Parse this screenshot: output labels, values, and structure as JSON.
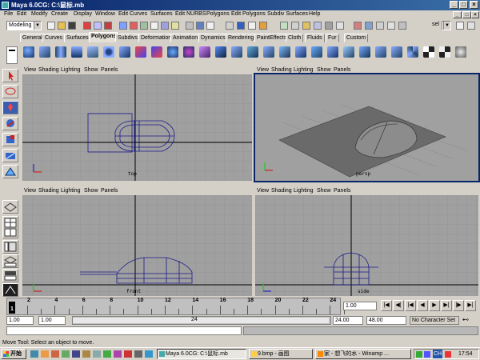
{
  "window": {
    "title": "Maya 6.0CG: C:\\鼠标.mb"
  },
  "menu": [
    "File",
    "Edit",
    "Modify",
    "Create",
    "Display",
    "Window",
    "Edit Curves",
    "Surfaces",
    "Edit NURBS",
    "Polygons",
    "Edit Polygons",
    "Subdiv Surfaces",
    "Help"
  ],
  "toolbar": {
    "mode": "Modeling",
    "sel_label": "sel"
  },
  "shelf_tabs": [
    "General",
    "Curves",
    "Surfaces",
    "Polygons",
    "Subdivs",
    "Deformation",
    "Animation",
    "Dynamics",
    "Rendering",
    "PaintEffects",
    "Cloth",
    "Fluids",
    "Fur",
    "Custom"
  ],
  "active_shelf": "Polygons",
  "viewports": {
    "menu": [
      "View",
      "Shading",
      "Lighting",
      "Show",
      "Panels"
    ],
    "top_label": "top",
    "persp_label": "persp",
    "front_label": "front",
    "side_label": "side"
  },
  "timeline": {
    "ticks": [
      "2",
      "4",
      "6",
      "8",
      "10",
      "12",
      "14",
      "16",
      "18",
      "20",
      "22",
      "24"
    ],
    "start_tick": "1",
    "current": "1.00"
  },
  "range": {
    "start": "1.00",
    "start2": "1.00",
    "range_label": "24",
    "end": "24.00",
    "end2": "48.00",
    "character_set": "No Character Set"
  },
  "help_text": "Move Tool: Select an object to move.",
  "taskbar": {
    "start": "开始",
    "items": [
      "Maya 6.0CG: C:\\鼠标.mb",
      "9.bmp - 画图",
      "家 - 想飞的水 - Winamp ..."
    ],
    "tray_lang": "CH",
    "clock": "17:54"
  },
  "colors": {
    "title_start": "#0a246a",
    "title_end": "#3a6ea5",
    "viewport_bg": "#a0a0a0",
    "wire": "#1a1a8c"
  }
}
